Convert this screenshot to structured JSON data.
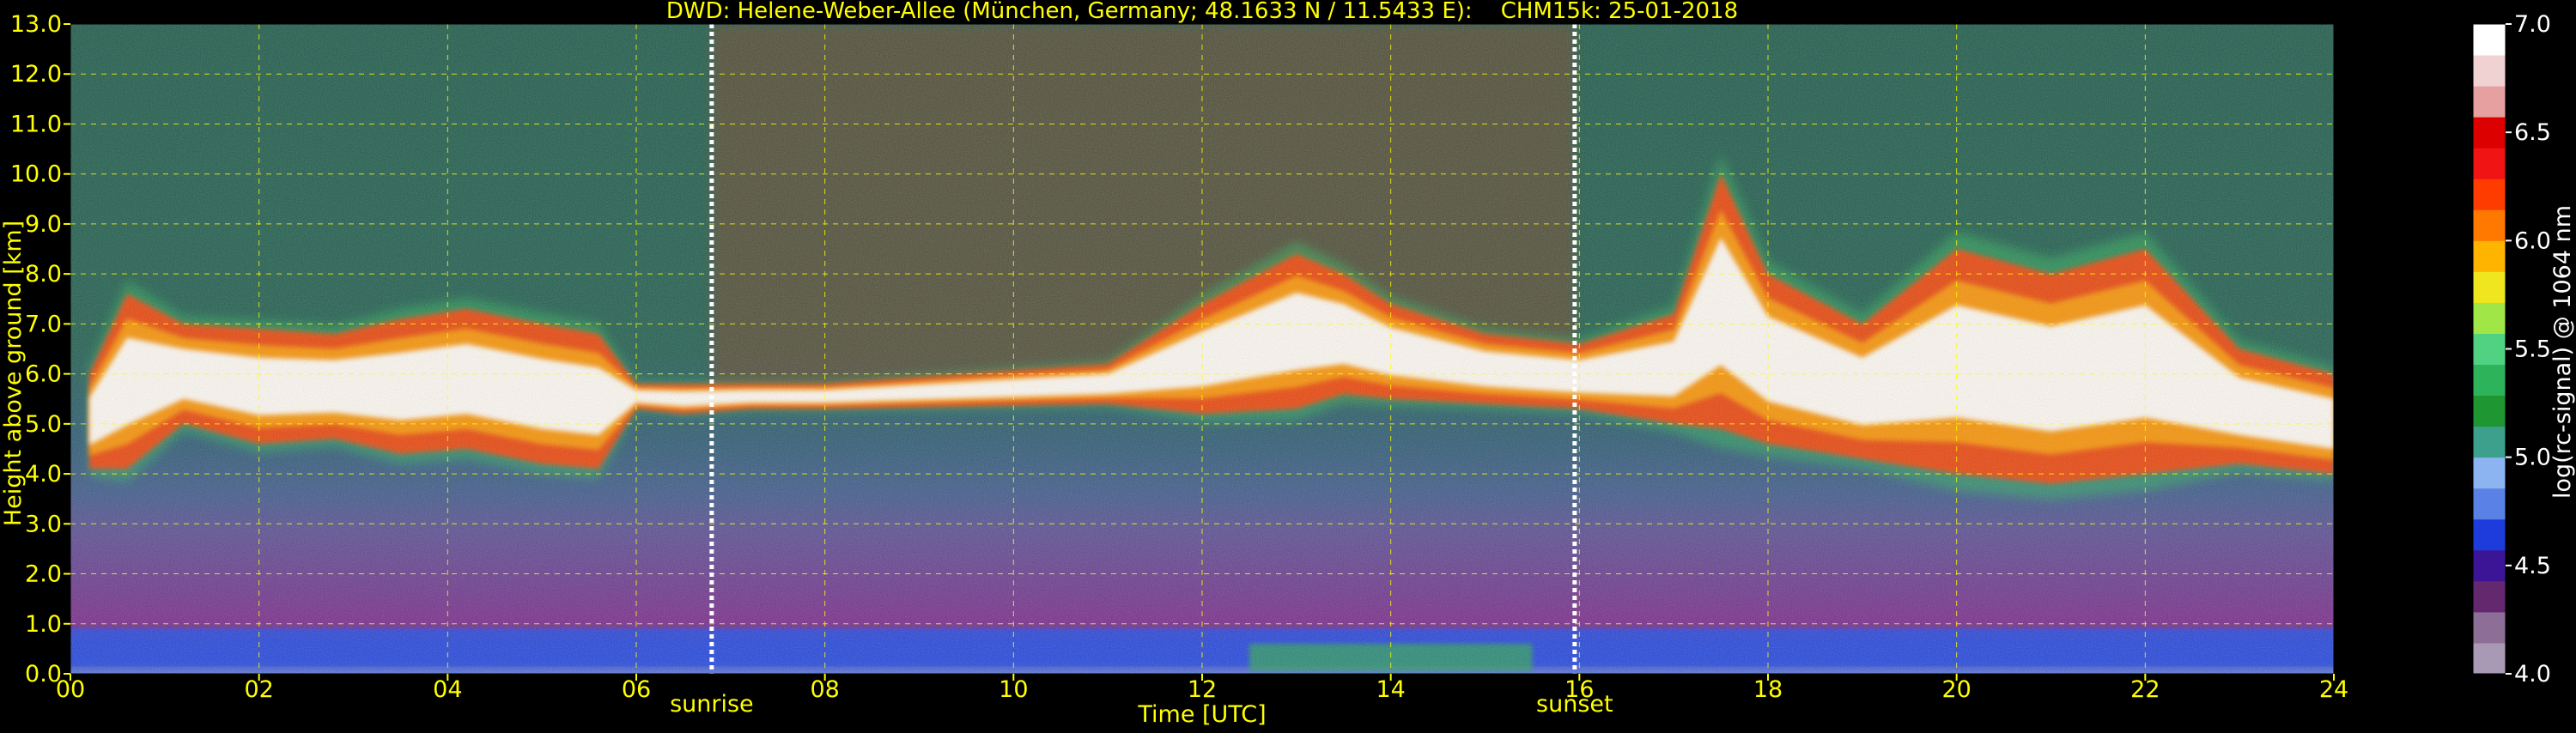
{
  "chart_data": {
    "type": "heatmap",
    "title": "DWD: Helene-Weber-Allee (München, Germany; 48.1633 N / 11.5433 E):    CHM15k: 25-01-2018",
    "xlabel": "Time [UTC]",
    "ylabel": "Height above ground [km]",
    "xlim": [
      0,
      24
    ],
    "ylim": [
      0,
      13
    ],
    "x_ticks": [
      0,
      2,
      4,
      6,
      8,
      10,
      12,
      14,
      16,
      18,
      20,
      22,
      24
    ],
    "x_tick_labels": [
      "00",
      "02",
      "04",
      "06",
      "08",
      "10",
      "12",
      "14",
      "16",
      "18",
      "20",
      "22",
      "24"
    ],
    "y_ticks": [
      0,
      1,
      2,
      3,
      4,
      5,
      6,
      7,
      8,
      9,
      10,
      11,
      12,
      13
    ],
    "y_tick_labels": [
      "0.0",
      "1.0",
      "2.0",
      "3.0",
      "4.0",
      "5.0",
      "6.0",
      "7.0",
      "8.0",
      "9.0",
      "10.0",
      "11.0",
      "12.0",
      "13.0"
    ],
    "grid": true,
    "colorbar": {
      "label": "log(rc-signal) @ 1064 nm",
      "range": [
        4.0,
        7.0
      ],
      "ticks": [
        4.0,
        4.5,
        5.0,
        5.5,
        6.0,
        6.5,
        7.0
      ],
      "tick_labels": [
        "4.0",
        "4.5",
        "5.0",
        "5.5",
        "6.0",
        "6.5",
        "7.0"
      ],
      "colors": [
        "#a89ab4",
        "#8c6e96",
        "#64286e",
        "#3c1496",
        "#1e3cdc",
        "#5a82e6",
        "#8cb4f0",
        "#3ca08c",
        "#1e9632",
        "#2db45a",
        "#50d282",
        "#a0e646",
        "#f0e61e",
        "#ffb400",
        "#ff7800",
        "#ff3c00",
        "#f01414",
        "#dc0000",
        "#e6a0a0",
        "#f0d2d2",
        "#ffffff"
      ]
    },
    "markers": [
      {
        "label": "sunrise",
        "time": 6.8
      },
      {
        "label": "sunset",
        "time": 15.95
      }
    ],
    "cloud_layer": [
      {
        "time": 0.2,
        "base": 4.1,
        "top": 6.0
      },
      {
        "time": 0.6,
        "base": 4.1,
        "top": 7.6
      },
      {
        "time": 1.2,
        "base": 5.0,
        "top": 7.0
      },
      {
        "time": 2.0,
        "base": 4.6,
        "top": 6.9
      },
      {
        "time": 2.8,
        "base": 4.7,
        "top": 6.8
      },
      {
        "time": 3.5,
        "base": 4.4,
        "top": 7.1
      },
      {
        "time": 4.2,
        "base": 4.5,
        "top": 7.3
      },
      {
        "time": 5.0,
        "base": 4.2,
        "top": 7.0
      },
      {
        "time": 5.6,
        "base": 4.1,
        "top": 6.8
      },
      {
        "time": 6.0,
        "base": 5.3,
        "top": 5.8
      },
      {
        "time": 6.5,
        "base": 5.2,
        "top": 5.8
      },
      {
        "time": 7.2,
        "base": 5.3,
        "top": 5.8
      },
      {
        "time": 8.0,
        "base": 5.3,
        "top": 5.8
      },
      {
        "time": 11.0,
        "base": 5.4,
        "top": 6.2
      },
      {
        "time": 12.0,
        "base": 5.2,
        "top": 7.4
      },
      {
        "time": 13.0,
        "base": 5.3,
        "top": 8.4
      },
      {
        "time": 13.5,
        "base": 5.6,
        "top": 8.0
      },
      {
        "time": 14.0,
        "base": 5.5,
        "top": 7.4
      },
      {
        "time": 15.0,
        "base": 5.4,
        "top": 6.8
      },
      {
        "time": 16.0,
        "base": 5.3,
        "top": 6.6
      },
      {
        "time": 17.0,
        "base": 5.0,
        "top": 7.2
      },
      {
        "time": 17.5,
        "base": 4.9,
        "top": 10.0
      },
      {
        "time": 18.0,
        "base": 4.6,
        "top": 8.0
      },
      {
        "time": 19.0,
        "base": 4.3,
        "top": 7.0
      },
      {
        "time": 20.0,
        "base": 4.0,
        "top": 8.5
      },
      {
        "time": 21.0,
        "base": 3.8,
        "top": 8.0
      },
      {
        "time": 22.0,
        "base": 4.0,
        "top": 8.5
      },
      {
        "time": 23.0,
        "base": 4.2,
        "top": 6.5
      },
      {
        "time": 24.0,
        "base": 4.0,
        "top": 6.0
      }
    ]
  },
  "style": {
    "text_color": "#ffff00",
    "white_text_color": "#ffffff",
    "grid_color": "#ffff00",
    "marker_color": "#ffffff",
    "background": "#000000"
  }
}
